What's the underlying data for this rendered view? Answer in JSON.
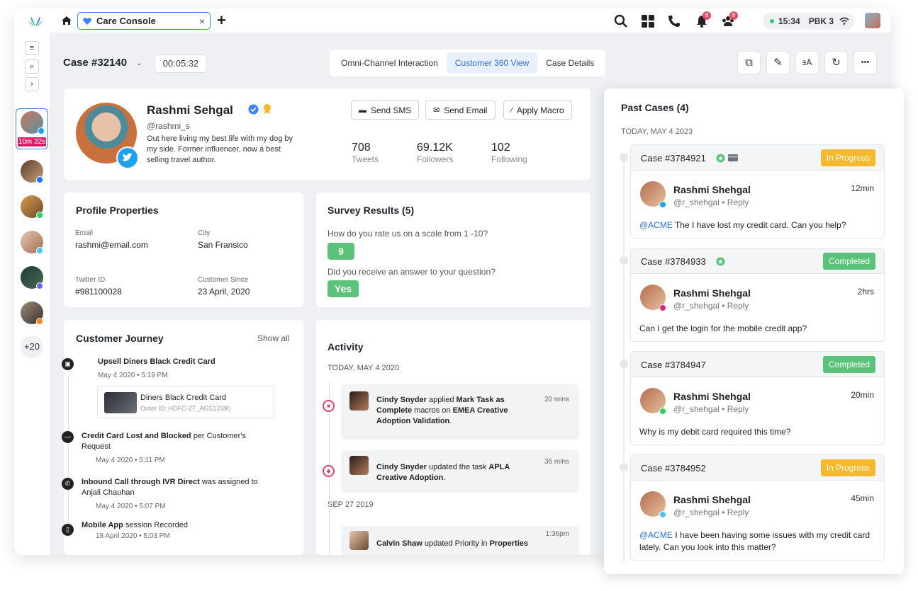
{
  "topbar": {
    "tab_label": "Care Console",
    "tab_close": "×",
    "plus": "+",
    "time": "15:34",
    "user_code": "PBK 3",
    "bell_count": "8",
    "team_count": "8"
  },
  "rail": {
    "nav_menu": "≡",
    "nav_search": "⌕",
    "nav_expand": "›",
    "active_timer": "10m 32s",
    "more_count": "+20"
  },
  "case": {
    "title": "Case #32140",
    "chevron": "⌄",
    "timer": "00:05:32"
  },
  "tabs": [
    {
      "label": "Omni-Channel Interaction"
    },
    {
      "label": "Customer 360 View"
    },
    {
      "label": "Case Details"
    }
  ],
  "toolbar": {
    "copy_icon": "⧉",
    "wand_icon": "✎",
    "translate_icon": "ⱻA",
    "refresh_icon": "↻",
    "more_icon": "•••"
  },
  "profile": {
    "name": "Rashmi Sehgal",
    "handle": "@rashmi_s",
    "bio": "Out here living my best life with my dog by my side. Former influencer, now a best selling travel author.",
    "tweets": "708",
    "tweets_label": "Tweets",
    "followers": "69.12K",
    "followers_label": "Followers",
    "following": "102",
    "following_label": "Following",
    "btn_sms": "Send SMS",
    "btn_email": "Send Email",
    "btn_macro": "Apply Macro"
  },
  "properties": {
    "title": "Profile Properties",
    "email_label": "Email",
    "email": "rashmi@email.com",
    "city_label": "City",
    "city": "San Fransico",
    "twitter_label": "Twitter ID",
    "twitter": "#981100028",
    "since_label": "Customer Since",
    "since": "23 April, 2020"
  },
  "survey": {
    "title": "Survey Results (5)",
    "q1": "How do you rate us on a scale from 1 -10?",
    "a1": "9",
    "q2": "Did you receive an answer to your question?",
    "a2": "Yes"
  },
  "journey": {
    "title": "Customer Journey",
    "show_all": "Show all",
    "items": [
      {
        "title": "Upsell Diners Black Credit Card",
        "date": "May 4 2020 • 5:19 PM"
      },
      {
        "title_bold": "Credit Card Lost and Blocked",
        "title_rest": " per Customer's Request",
        "date": "May 4 2020 • 5:11 PM"
      },
      {
        "title_bold": "Inbound Call through IVR Direct",
        "title_rest": " was assigned to Anjali Chauhan",
        "date": "May 4 2020 • 5:07 PM"
      },
      {
        "title_bold": "Mobile App",
        "title_rest": " session Recorded",
        "date": "18 April 2020 • 5:03 PM"
      }
    ],
    "card_name": "Diners Black Credit Card",
    "card_order": "Order ID: HDFC-ZT_AGS12390"
  },
  "activity": {
    "title": "Activity",
    "date1": "TODAY, MAY 4 2020",
    "date2": "SEP 27 2019",
    "items": [
      {
        "a": "Cindy Snyder",
        "b": " applied ",
        "c": "Mark Task as Complete",
        "d": " macros on ",
        "e": "EMEA Creative Adoption Validation",
        "f": ".",
        "time": "20 mins"
      },
      {
        "a": "Cindy Snyder",
        "b": " updated the task ",
        "c": "APLA Creative Adoption",
        "d": ".",
        "time": "36 mins"
      },
      {
        "a": "Calvin Shaw",
        "b": " updated Priority in ",
        "c": "Properties",
        "d": "",
        "time": "1:36pm"
      }
    ]
  },
  "past": {
    "title": "Past Cases (4)",
    "date": "TODAY, MAY 4 2023",
    "cases": [
      {
        "id": "Case #3784921",
        "status": "In Progress",
        "name": "Rashmi Shehgal",
        "handle": "@r_shehgal • Reply",
        "time": "12min",
        "mention": "@ACME",
        "msg": " The I have lost my credit card. Can you help?"
      },
      {
        "id": "Case #3784933",
        "status": "Completed",
        "name": "Rashmi Shehgal",
        "handle": "@r_shehgal • Reply",
        "time": "2hrs",
        "mention": "",
        "msg": "Can I get the login for the mobile credit app?"
      },
      {
        "id": "Case #3784947",
        "status": "Completed",
        "name": "Rashmi Shehgal",
        "handle": "@r_shehgal • Reply",
        "time": "20min",
        "mention": "",
        "msg": "Why is my debit card required this time?"
      },
      {
        "id": "Case #3784952",
        "status": "In Progress",
        "name": "Rashmi Shehgal",
        "handle": "@r_shehgal • Reply",
        "time": "45min",
        "mention": "@ACME",
        "msg": " I have been having some issues with my credit card lately. Can you look into this matter?"
      }
    ]
  },
  "colors": {
    "in_progress": "#f5b82e",
    "completed": "#5bc27a",
    "accent": "#3b82f6",
    "timer_badge": "#d61f69"
  }
}
